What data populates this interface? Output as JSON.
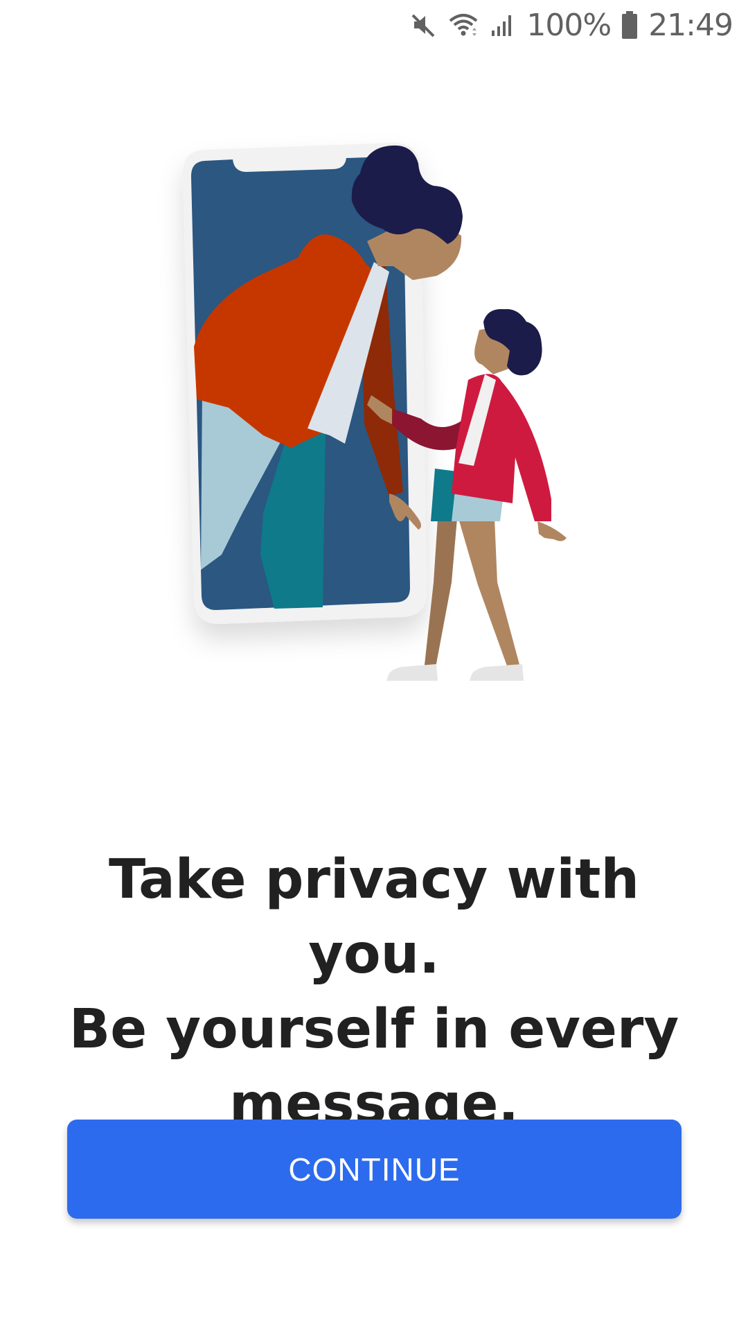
{
  "status_bar": {
    "battery_percent": "100%",
    "time": "21:49",
    "icons": [
      "mute-icon",
      "wifi-icon",
      "signal-icon",
      "battery-icon"
    ]
  },
  "illustration": {
    "icon": "person-leaning-out-of-phone-illustration"
  },
  "onboarding": {
    "headline_line1": "Take privacy with you.",
    "headline_line2": "Be yourself in every",
    "headline_line3": "message."
  },
  "actions": {
    "continue_label": "CONTINUE"
  },
  "colors": {
    "accent": "#2c6bed",
    "text": "#212121",
    "background": "#ffffff"
  }
}
